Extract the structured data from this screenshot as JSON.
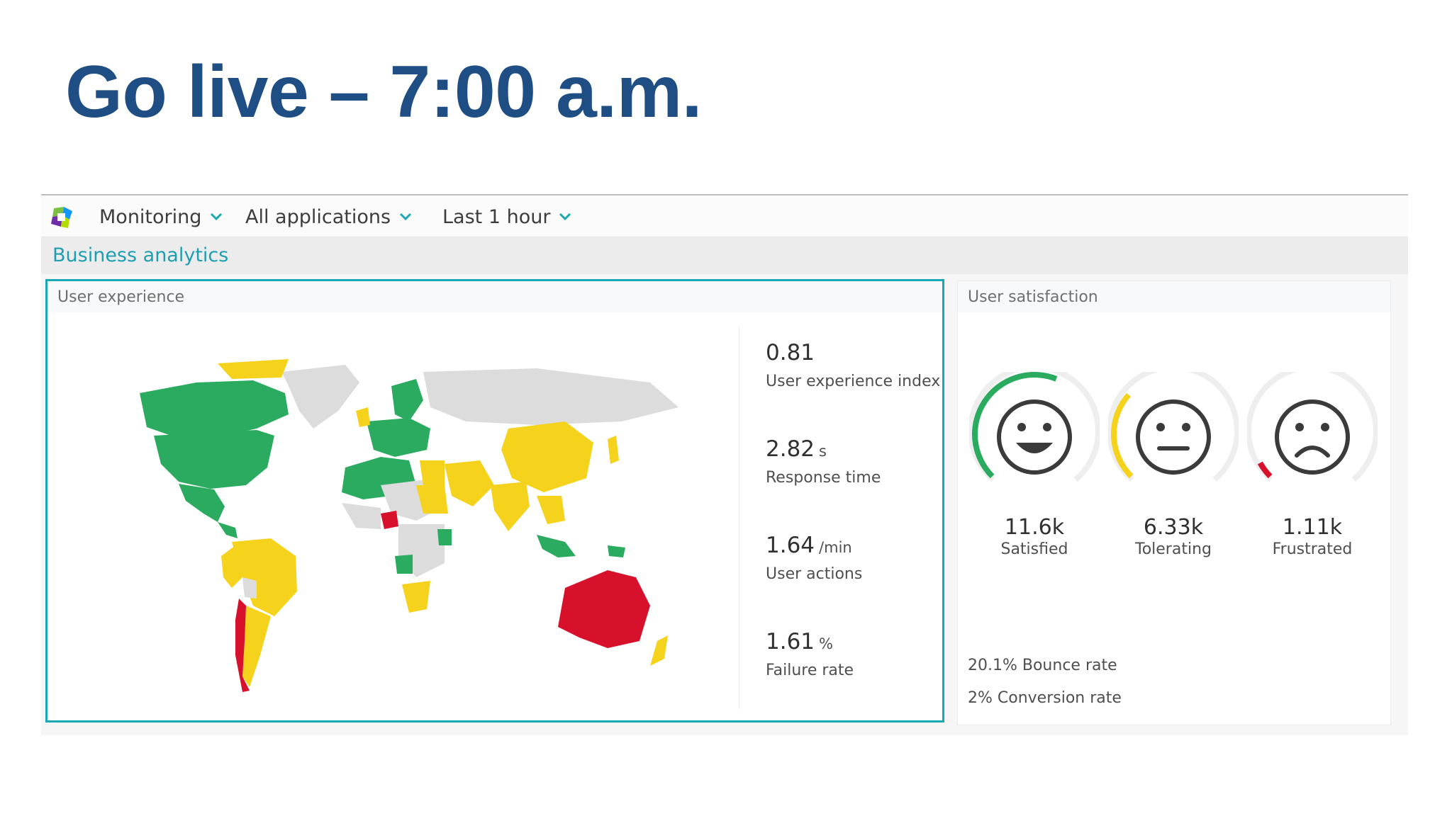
{
  "slide": {
    "title": "Go live – 7:00 a.m."
  },
  "navbar": {
    "logo": "dynatrace-logo",
    "monitoring": "Monitoring",
    "applications": "All applications",
    "timeframe": "Last 1 hour"
  },
  "subheader": {
    "title": "Business analytics"
  },
  "user_experience": {
    "title": "User experience",
    "metrics": [
      {
        "value": "0.81",
        "unit": "",
        "label": "User experience index"
      },
      {
        "value": "2.82",
        "unit": "s",
        "label": "Response time"
      },
      {
        "value": "1.64",
        "unit": "/min",
        "label": "User actions"
      },
      {
        "value": "1.61",
        "unit": "%",
        "label": "Failure rate"
      }
    ],
    "map_colors": {
      "satisfied": "#2bab5f",
      "tolerating": "#f5d21b",
      "frustrated": "#d7112b",
      "nodata": "#dcdcdc"
    }
  },
  "user_satisfaction": {
    "title": "User satisfaction",
    "gauges": [
      {
        "value": "11.6k",
        "label": "Satisfied",
        "level": 0.58,
        "color": "#2bab5f",
        "icon": "happy-face-icon"
      },
      {
        "value": "6.33k",
        "label": "Tolerating",
        "level": 0.32,
        "color": "#f5d21b",
        "icon": "neutral-face-icon"
      },
      {
        "value": "1.11k",
        "label": "Frustrated",
        "level": 0.06,
        "color": "#d7112b",
        "icon": "sad-face-icon"
      }
    ],
    "bounce_rate": "20.1% Bounce rate",
    "conversion_rate": "2% Conversion rate"
  }
}
